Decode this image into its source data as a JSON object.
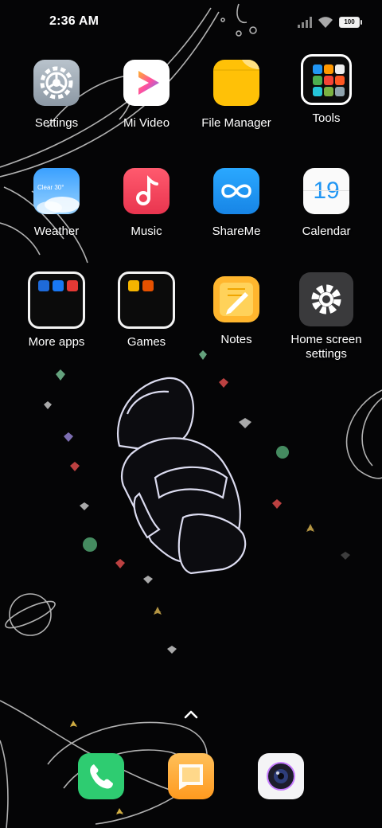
{
  "status_bar": {
    "time": "2:36 AM",
    "battery_level": "100",
    "icons": [
      "signal-icon",
      "wifi-icon",
      "battery-icon"
    ]
  },
  "home": {
    "apps": [
      {
        "label": "Settings",
        "icon": "settings-gear-icon"
      },
      {
        "label": "Mi Video",
        "icon": "mi-video-play-icon"
      },
      {
        "label": "File Manager",
        "icon": "file-folder-icon"
      },
      {
        "label": "Tools",
        "icon": "tools-folder-icon"
      },
      {
        "label": "Weather",
        "icon": "weather-cloud-icon",
        "badge": "Clear 30°"
      },
      {
        "label": "Music",
        "icon": "music-note-icon"
      },
      {
        "label": "ShareMe",
        "icon": "shareme-infinity-icon"
      },
      {
        "label": "Calendar",
        "icon": "calendar-icon",
        "day": "19"
      },
      {
        "label": "More apps",
        "icon": "more-apps-folder-icon"
      },
      {
        "label": "Games",
        "icon": "games-folder-icon"
      },
      {
        "label": "Notes",
        "icon": "notes-pencil-icon"
      },
      {
        "label": "Home screen settings",
        "icon": "home-settings-gear-icon"
      }
    ]
  },
  "dock": {
    "apps": [
      {
        "name": "Phone",
        "icon": "phone-icon"
      },
      {
        "name": "Messages",
        "icon": "messages-icon"
      },
      {
        "name": "Camera",
        "icon": "camera-icon"
      }
    ]
  },
  "colors": {
    "background": "#050506",
    "file_manager": "#FFC107",
    "music": "#F2455E",
    "shareme": "#1E9BF0",
    "notes": "#FFB62E",
    "phone": "#2ECC71",
    "messages": "#FFA934"
  }
}
